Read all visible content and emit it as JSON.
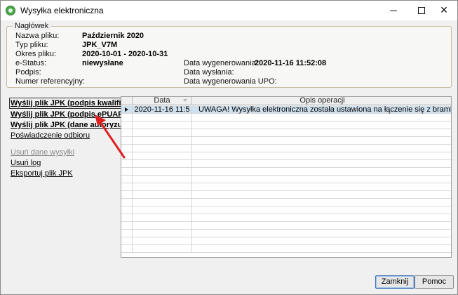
{
  "window": {
    "title": "Wysyłka elektroniczna"
  },
  "header": {
    "legend": "Nagłówek",
    "left_fields": [
      {
        "label": "Nazwa pliku:",
        "value": "Październik 2020"
      },
      {
        "label": "Typ pliku:",
        "value": "JPK_V7M"
      },
      {
        "label": "Okres pliku:",
        "value": "2020-10-01 - 2020-10-31"
      },
      {
        "label": "e-Status:",
        "value": "niewysłane"
      },
      {
        "label": "Podpis:",
        "value": ""
      },
      {
        "label": "Numer referencyjny:",
        "value": ""
      }
    ],
    "right_fields": [
      {
        "label": "Data wygenerowania:",
        "value": "2020-11-16 11:52:08"
      },
      {
        "label": "Data wysłania:",
        "value": ""
      },
      {
        "label": "Data wygenerowania UPO:",
        "value": ""
      }
    ]
  },
  "actions": [
    {
      "label": "Wyślij plik JPK (podpis kwalifikowany)"
    },
    {
      "label": "Wyślij plik JPK (podpis ePUAP)"
    },
    {
      "label": "Wyślij plik JPK (dane autoryzujące)"
    },
    {
      "label": "Poświadczenie odbioru"
    },
    {
      "label": "Usuń dane wysyłki"
    },
    {
      "label": "Usuń log"
    },
    {
      "label": "Eksportuj plik JPK"
    }
  ],
  "grid": {
    "columns": [
      "Data",
      "Opis operacji"
    ],
    "rows": [
      {
        "data": "2020-11-16 11:5",
        "opis": "UWAGA! Wysyłka elektroniczna została ustawiona na łączenie się z bramką testową"
      }
    ]
  },
  "buttons": {
    "close": "Zamknij",
    "help": "Pomoc"
  },
  "colors": {
    "annotation_arrow": "#e02020",
    "selected_row": "#cfe0ee"
  }
}
